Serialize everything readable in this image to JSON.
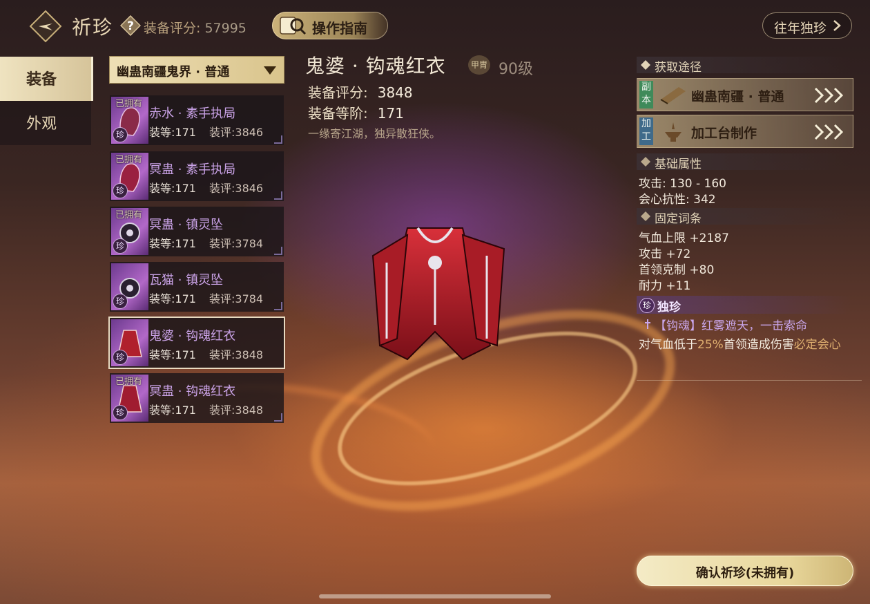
{
  "header": {
    "title": "祈珍",
    "score_label": "装备评分:",
    "score_value": "57995",
    "guide_label": "操作指南",
    "past_label": "往年独珍"
  },
  "tabs": [
    {
      "label": "装备",
      "active": true
    },
    {
      "label": "外观",
      "active": false
    }
  ],
  "dropdown": {
    "selected": "幽蛊南疆鬼界 · 普通"
  },
  "list": [
    {
      "owned": "已拥有",
      "name": "赤水 · 素手执局",
      "level": "装等:171",
      "score": "装评:3846",
      "rarity": "珍"
    },
    {
      "owned": "已拥有",
      "name": "冥蛊 · 素手执局",
      "level": "装等:171",
      "score": "装评:3846",
      "rarity": "珍"
    },
    {
      "owned": "已拥有",
      "name": "冥蛊 · 镇灵坠",
      "level": "装等:171",
      "score": "装评:3784",
      "rarity": "珍"
    },
    {
      "owned": "",
      "name": "瓦猫 · 镇灵坠",
      "level": "装等:171",
      "score": "装评:3784",
      "rarity": "珍"
    },
    {
      "owned": "",
      "name": "鬼婆 · 钩魂红衣",
      "level": "装等:171",
      "score": "装评:3848",
      "rarity": "珍",
      "selected": true
    },
    {
      "owned": "已拥有",
      "name": "冥蛊 · 钩魂红衣",
      "level": "装等:171",
      "score": "装评:3848",
      "rarity": "珍"
    }
  ],
  "detail": {
    "name": "鬼婆 · 钩魂红衣",
    "type_badge": "甲胄",
    "level": "90级",
    "score_label": "装备评分:",
    "score_value": "3848",
    "tier_label": "装备等阶:",
    "tier_value": "171",
    "flavor": "一缘寄江湖，独异散狂侠。"
  },
  "sources": {
    "title": "获取途径",
    "rows": [
      {
        "tag": "副本",
        "label": "幽蛊南疆 · 普通",
        "tag_color": "#3f8a5a"
      },
      {
        "tag": "加工",
        "label": "加工台制作",
        "tag_color": "#3f6a8a"
      }
    ]
  },
  "base_attrs": {
    "title": "基础属性",
    "rows": [
      "攻击: 130 - 160",
      "会心抗性: 342"
    ]
  },
  "fixed_attrs": {
    "title": "固定词条",
    "rows": [
      "气血上限 +2187",
      "攻击 +72",
      "首领克制 +80",
      "耐力 +11"
    ]
  },
  "unique": {
    "title": "独珍",
    "rarity": "珍",
    "skill_name": "【钩魂】红雾遮天，一击索命",
    "desc_a": "对气血低于",
    "desc_pct": "25%",
    "desc_b": "首领造成伤害",
    "desc_hl": "必定会心"
  },
  "confirm_label": "确认祈珍(未拥有)",
  "colors": {
    "accent_gold": "#e8d69a",
    "name_purple": "#c9a2e6"
  }
}
